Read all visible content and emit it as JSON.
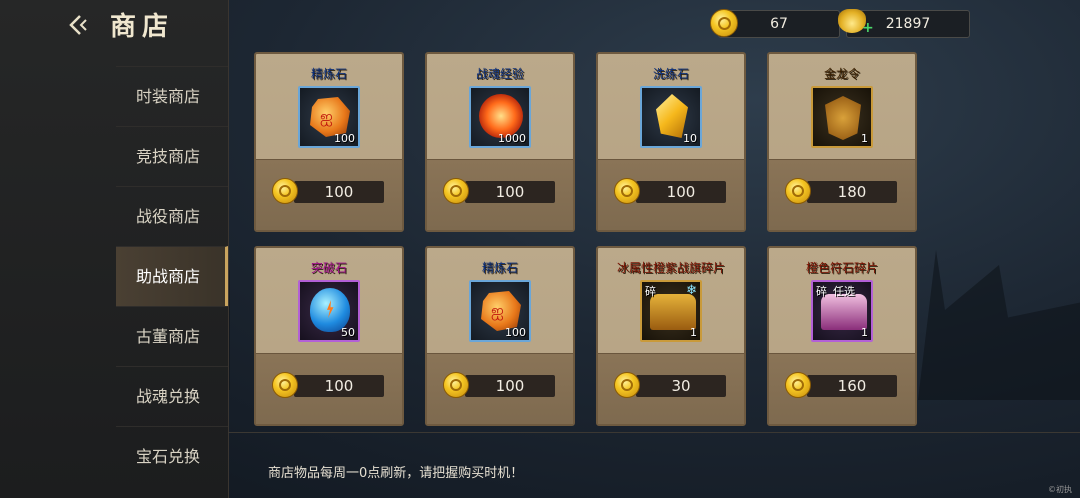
{
  "header": {
    "title": "商店"
  },
  "sidebar": {
    "items": [
      {
        "label": "时装商店",
        "active": false
      },
      {
        "label": "竞技商店",
        "active": false
      },
      {
        "label": "战役商店",
        "active": false
      },
      {
        "label": "助战商店",
        "active": true
      },
      {
        "label": "古董商店",
        "active": false
      },
      {
        "label": "战魂兑换",
        "active": false
      },
      {
        "label": "宝石兑换",
        "active": false
      }
    ]
  },
  "currency": {
    "coins": "67",
    "ingots": "21897"
  },
  "shop": {
    "items": [
      {
        "name": "精炼石",
        "name_color": "#0a2e7a",
        "qty": "100",
        "price": "100",
        "icon": "orange-ore-icon",
        "rarity": "blue"
      },
      {
        "name": "战魂经验",
        "name_color": "#0a2e7a",
        "qty": "1000",
        "price": "100",
        "icon": "fire-orb-icon",
        "rarity": "blue"
      },
      {
        "name": "洗练石",
        "name_color": "#0a2e7a",
        "qty": "10",
        "price": "100",
        "icon": "crystal-icon",
        "rarity": "blue"
      },
      {
        "name": "金龙令",
        "name_color": "#3a1f00",
        "qty": "1",
        "price": "180",
        "icon": "dragon-token-icon",
        "rarity": "gold"
      },
      {
        "name": "突破石",
        "name_color": "#a0108a",
        "qty": "50",
        "price": "100",
        "icon": "blue-gem-icon",
        "rarity": "purple"
      },
      {
        "name": "精炼石",
        "name_color": "#0a2e7a",
        "qty": "100",
        "price": "100",
        "icon": "orange-ore-icon",
        "rarity": "blue"
      },
      {
        "name": "冰属性橙紫战旗碎片",
        "name_color": "#7a1404",
        "qty": "1",
        "price": "30",
        "icon": "war-flag-chest-icon",
        "rarity": "gold",
        "tag": "碎"
      },
      {
        "name": "橙色符石碎片",
        "name_color": "#7a1404",
        "qty": "1",
        "price": "160",
        "icon": "rune-chest-icon",
        "rarity": "purple",
        "tag": "碎",
        "tag2": "任选"
      }
    ]
  },
  "footer": {
    "note": "商店物品每周一0点刷新，请把握购买时机！"
  },
  "watermark": "©初执"
}
